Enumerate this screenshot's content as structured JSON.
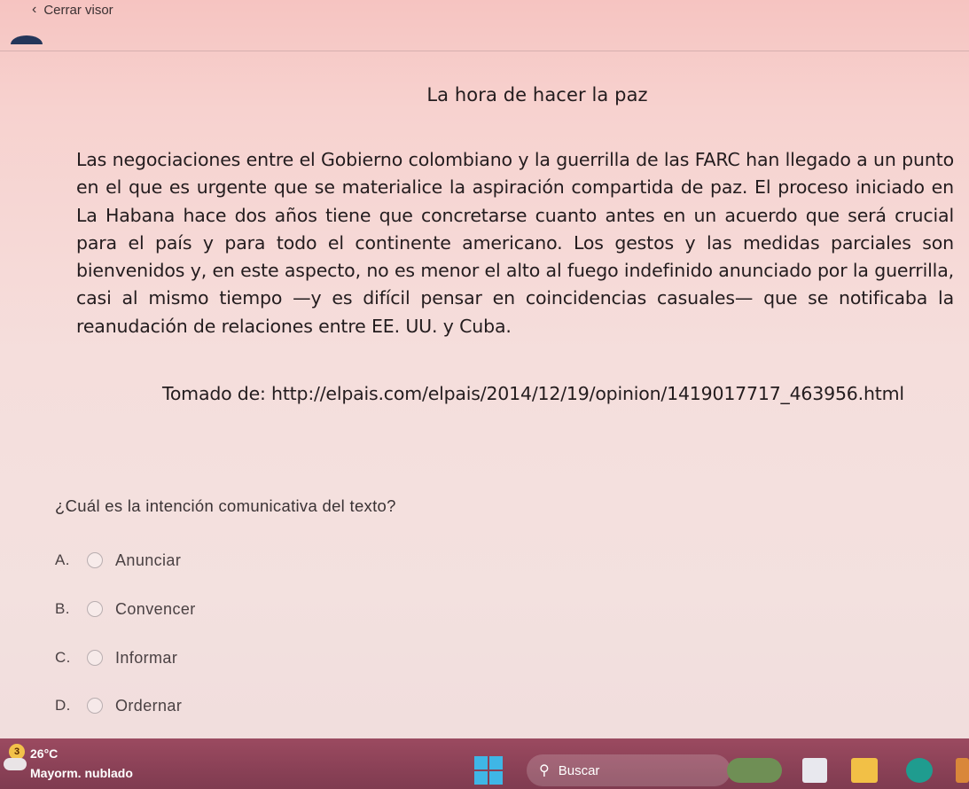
{
  "viewer": {
    "close_label": "Cerrar visor"
  },
  "document": {
    "title": "La hora de hacer la paz",
    "body": "Las negociaciones entre el Gobierno colombiano y la guerrilla de las FARC han llegado a un punto en el que es urgente que se materialice la aspiración compartida de paz. El proceso iniciado en La Habana hace dos años tiene que concretarse cuanto antes en un acuerdo que será crucial para el país y para todo el continente americano. Los gestos y las medidas parciales son bienvenidos y, en este aspecto, no es menor el alto al fuego indefinido anunciado por la guerrilla, casi al mismo tiempo —y es difícil pensar en coincidencias casuales— que se notificaba la reanudación de relaciones entre EE. UU. y Cuba.",
    "source": "Tomado de: http://elpais.com/elpais/2014/12/19/opinion/1419017717_463956.html"
  },
  "quiz": {
    "question": "¿Cuál es la intención comunicativa del texto?",
    "options": [
      {
        "letter": "A.",
        "label": "Anunciar"
      },
      {
        "letter": "B.",
        "label": "Convencer"
      },
      {
        "letter": "C.",
        "label": "Informar"
      },
      {
        "letter": "D.",
        "label": "Ordernar"
      }
    ]
  },
  "taskbar": {
    "weather_badge": "3",
    "temperature": "26°C",
    "condition": "Mayorm. nublado",
    "search_label": "Buscar"
  },
  "icons": {
    "back": "chevron-left-icon",
    "search": "search-icon",
    "start": "windows-start-icon"
  },
  "colors": {
    "taskbar": "#8a4258",
    "start_accent": "#3fb6e6"
  }
}
